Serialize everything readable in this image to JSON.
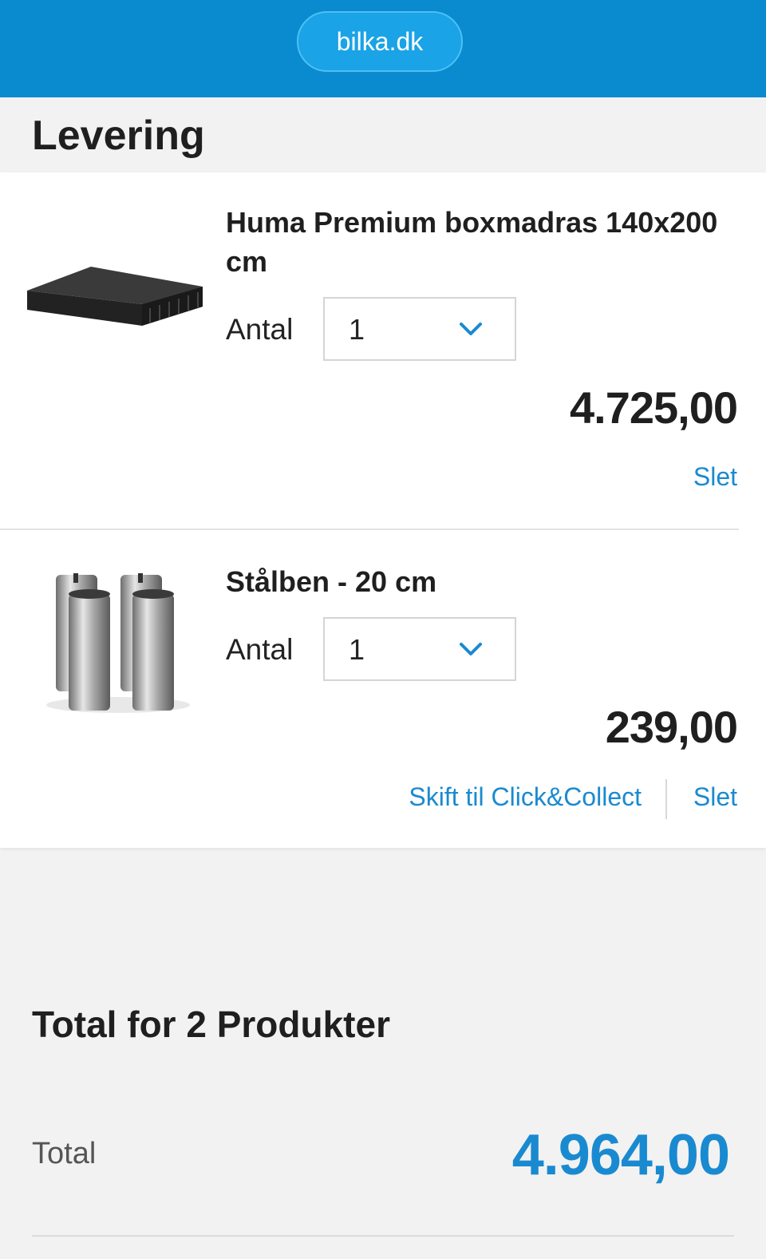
{
  "browser": {
    "url": "bilka.dk"
  },
  "section": {
    "title": "Levering"
  },
  "items": [
    {
      "name": "Huma Premium boxmadras 140x200 cm",
      "qty_label": "Antal",
      "qty_value": "1",
      "price": "4.725,00",
      "delete_label": "Slet",
      "image_icon": "mattress-image"
    },
    {
      "name": "Stålben - 20 cm",
      "qty_label": "Antal",
      "qty_value": "1",
      "price": "239,00",
      "switch_label": "Skift til Click&Collect",
      "delete_label": "Slet",
      "image_icon": "steel-legs-image"
    }
  ],
  "summary": {
    "heading": "Total for 2 Produkter",
    "total_label": "Total",
    "total_value": "4.964,00"
  },
  "colors": {
    "brand_blue": "#0a8bd0",
    "link_blue": "#1a8ad0",
    "background": "#f2f2f2"
  }
}
